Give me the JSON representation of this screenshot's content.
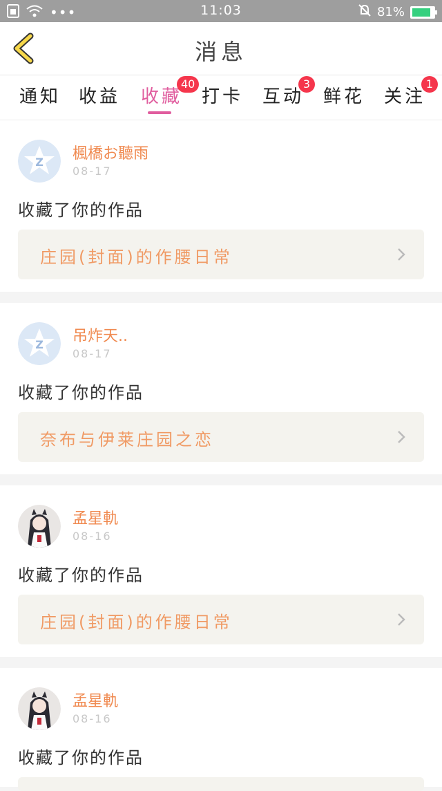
{
  "status_bar": {
    "time": "11:03",
    "battery": "81%"
  },
  "header": {
    "title": "消息"
  },
  "tabs": [
    {
      "label": "通知",
      "badge": ""
    },
    {
      "label": "收益",
      "badge": ""
    },
    {
      "label": "收藏",
      "badge": "40",
      "active": true
    },
    {
      "label": "打卡",
      "badge": ""
    },
    {
      "label": "互动",
      "badge": "3"
    },
    {
      "label": "鲜花",
      "badge": ""
    },
    {
      "label": "关注",
      "badge": "1"
    }
  ],
  "colors": {
    "accent": "#e05d9e",
    "username": "#f08a50",
    "badge": "#f5364c"
  },
  "messages": [
    {
      "user": "楓橋お聽雨",
      "date": "08-17",
      "action": "收藏了你的作品",
      "work": "庄园(封面)的作腰日常",
      "avatar": "default-avatar-icon"
    },
    {
      "user": "吊炸天..",
      "date": "08-17",
      "action": "收藏了你的作品",
      "work": "奈布与伊莱庄园之恋",
      "avatar": "default-avatar-icon"
    },
    {
      "user": "孟星軌",
      "date": "08-16",
      "action": "收藏了你的作品",
      "work": "庄园(封面)的作腰日常",
      "avatar": "anime-avatar"
    },
    {
      "user": "孟星軌",
      "date": "08-16",
      "action": "收藏了你的作品",
      "work": "",
      "avatar": "anime-avatar"
    }
  ]
}
